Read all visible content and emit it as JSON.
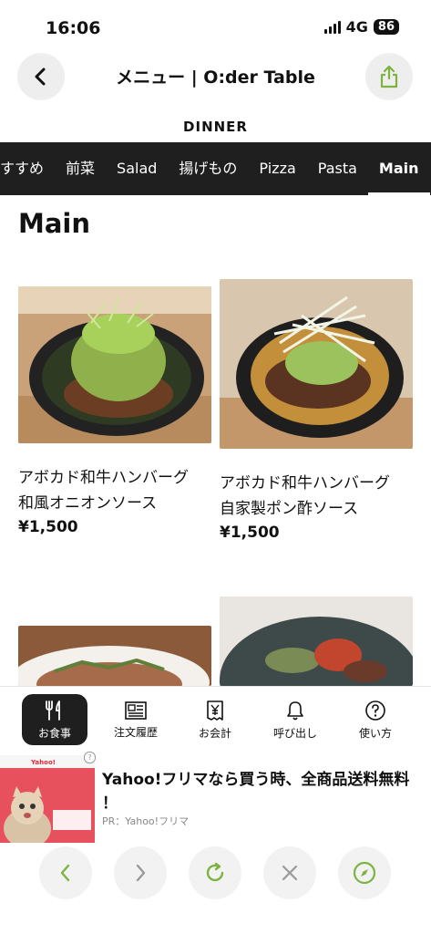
{
  "status": {
    "time": "16:06",
    "network": "4G",
    "battery": "86"
  },
  "header": {
    "title": "メニュー | O:der Table",
    "back_icon": "chevron-left-icon",
    "share_icon": "share-icon"
  },
  "section": {
    "label": "DINNER"
  },
  "categories": [
    "すすめ",
    "前菜",
    "Salad",
    "揚げもの",
    "Pizza",
    "Pasta",
    "Main"
  ],
  "active_category": "Main",
  "main": {
    "heading": "Main",
    "items": [
      {
        "name": "アボカド和牛ハンバーグ　和風オニオンソース",
        "price": "¥1,500"
      },
      {
        "name": "アボカド和牛ハンバーグ　自家製ポン酢ソース",
        "price": "¥1,500"
      }
    ]
  },
  "tabbar": {
    "tabs": [
      {
        "label": "お食事",
        "icon": "fork-knife-icon"
      },
      {
        "label": "注文履歴",
        "icon": "history-icon"
      },
      {
        "label": "お会計",
        "icon": "receipt-yen-icon"
      },
      {
        "label": "呼び出し",
        "icon": "bell-icon"
      },
      {
        "label": "使い方",
        "icon": "help-icon"
      }
    ]
  },
  "ad": {
    "text": "Yahoo!フリマなら買う時、全商品送料無料 ！",
    "sponsor": "PR：Yahoo!フリマ",
    "image_brand": "Yahoo!フリマ"
  },
  "colors": {
    "accent_green": "#7cb342",
    "dark": "#1f1f1f",
    "ad_bg": "#e7505d"
  }
}
